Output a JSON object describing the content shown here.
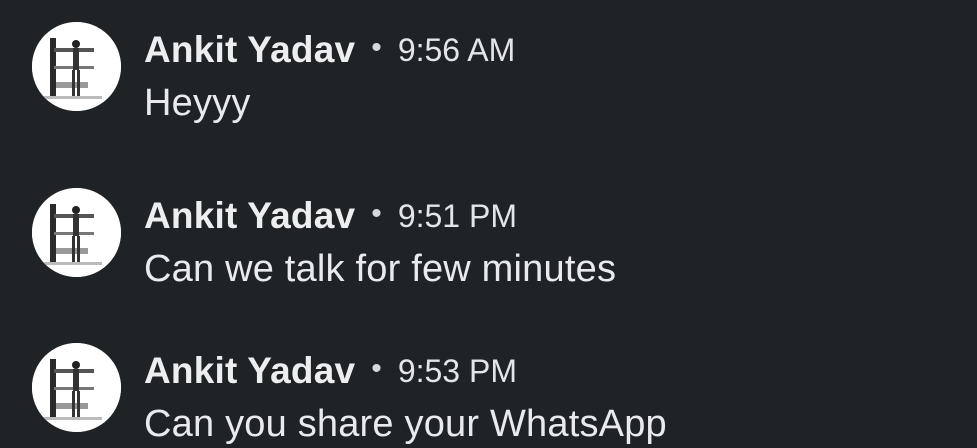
{
  "messages": [
    {
      "sender": "Ankit Yadav",
      "separator": "•",
      "time": "9:56 AM",
      "text": "Heyyy",
      "avatar_icon": "profile-photo-icon"
    },
    {
      "sender": "Ankit Yadav",
      "separator": "•",
      "time": "9:51 PM",
      "text": "Can we talk for few minutes",
      "avatar_icon": "profile-photo-icon"
    },
    {
      "sender": "Ankit Yadav",
      "separator": "•",
      "time": "9:53 PM",
      "text": "Can you share your WhatsApp",
      "avatar_icon": "profile-photo-icon"
    }
  ],
  "colors": {
    "background": "#1f2326",
    "text": "#e8eaed",
    "avatar_background": "#ffffff"
  }
}
